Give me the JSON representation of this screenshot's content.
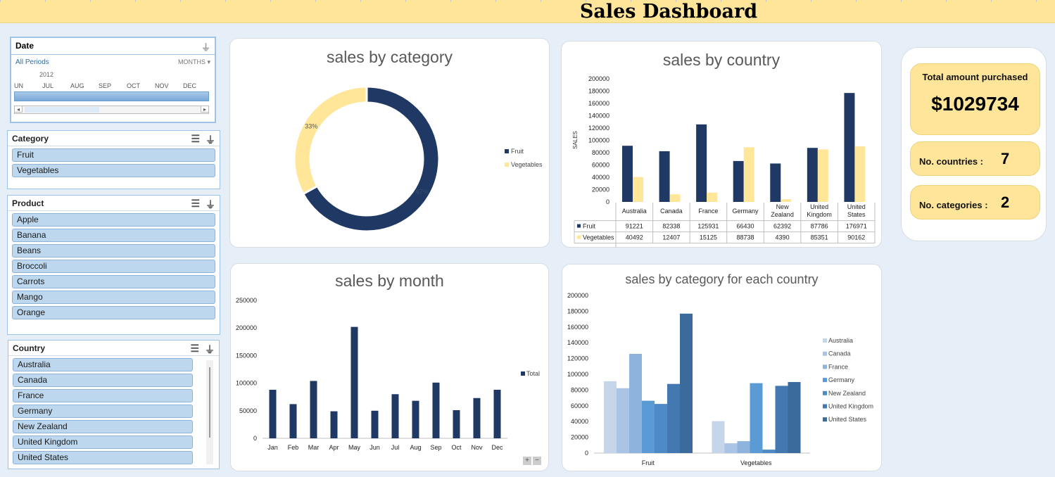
{
  "header": {
    "title": "Sales Dashboard"
  },
  "date_slicer": {
    "title": "Date",
    "all_periods": "All Periods",
    "period_select": "MONTHS",
    "year": "2012",
    "months": [
      "UN",
      "JUL",
      "AUG",
      "SEP",
      "OCT",
      "NOV",
      "DEC"
    ]
  },
  "category_slicer": {
    "title": "Category",
    "items": [
      {
        "label": "Fruit"
      },
      {
        "label": "Vegetables"
      }
    ]
  },
  "product_slicer": {
    "title": "Product",
    "items": [
      {
        "label": "Apple"
      },
      {
        "label": "Banana"
      },
      {
        "label": "Beans"
      },
      {
        "label": "Broccoli"
      },
      {
        "label": "Carrots"
      },
      {
        "label": "Mango"
      },
      {
        "label": "Orange"
      }
    ]
  },
  "country_slicer": {
    "title": "Country",
    "items": [
      {
        "label": "Australia"
      },
      {
        "label": "Canada"
      },
      {
        "label": "France"
      },
      {
        "label": "Germany"
      },
      {
        "label": "New Zealand"
      },
      {
        "label": "United Kingdom"
      },
      {
        "label": "United States"
      }
    ]
  },
  "kpis": {
    "total_label": "Total amount purchased",
    "total_value": "$1029734",
    "countries_label": "No. countries :",
    "countries_value": "7",
    "categories_label": "No. categories :",
    "categories_value": "2"
  },
  "colors": {
    "fruit": "#203864",
    "vegetables": "#ffe699"
  },
  "chart_data": [
    {
      "id": "category",
      "type": "pie",
      "title": "sales by category",
      "labels": [
        "Fruit",
        "Vegetables"
      ],
      "values": [
        67,
        33
      ],
      "data_labels": [
        "67%",
        "33%"
      ],
      "legend": "right"
    },
    {
      "id": "country",
      "type": "bar",
      "title": "sales by country",
      "ylabel": "SALES",
      "ylim": [
        0,
        200000
      ],
      "yticks": [
        "0",
        "20000",
        "40000",
        "60000",
        "80000",
        "100000",
        "120000",
        "140000",
        "160000",
        "180000",
        "200000"
      ],
      "categories": [
        "Australia",
        "Canada",
        "France",
        "Germany",
        "New Zealand",
        "United Kingdom",
        "United States"
      ],
      "series": [
        {
          "name": "Fruit",
          "values": [
            91221,
            82338,
            125931,
            66430,
            62392,
            87786,
            176971
          ]
        },
        {
          "name": "Vegetables",
          "values": [
            40492,
            12407,
            15125,
            88738,
            4390,
            85351,
            90162
          ]
        }
      ],
      "data_table": true
    },
    {
      "id": "month",
      "type": "bar",
      "title": "sales by month",
      "ylim": [
        0,
        250000
      ],
      "yticks": [
        "0",
        "50000",
        "100000",
        "150000",
        "200000",
        "250000"
      ],
      "categories": [
        "Jan",
        "Feb",
        "Mar",
        "Apr",
        "May",
        "Jun",
        "Jul",
        "Aug",
        "Sep",
        "Oct",
        "Nov",
        "Dec"
      ],
      "series": [
        {
          "name": "Total",
          "values": [
            88000,
            62000,
            104000,
            49000,
            202000,
            50000,
            80000,
            68000,
            101000,
            51000,
            73000,
            88000
          ]
        }
      ],
      "legend": "right"
    },
    {
      "id": "catcountry",
      "type": "bar",
      "title": "sales by category for each country",
      "ylim": [
        0,
        200000
      ],
      "yticks": [
        "0",
        "20000",
        "40000",
        "60000",
        "80000",
        "100000",
        "120000",
        "140000",
        "160000",
        "180000",
        "200000"
      ],
      "categories": [
        "Fruit",
        "Vegetables"
      ],
      "series": [
        {
          "name": "Australia",
          "values": [
            91221,
            40492
          ],
          "color": "#c5d5ea"
        },
        {
          "name": "Canada",
          "values": [
            82338,
            12407
          ],
          "color": "#a9c4e4"
        },
        {
          "name": "France",
          "values": [
            125931,
            15125
          ],
          "color": "#8eb3dd"
        },
        {
          "name": "Germany",
          "values": [
            66430,
            88738
          ],
          "color": "#5b9bd5"
        },
        {
          "name": "New Zealand",
          "values": [
            62392,
            4390
          ],
          "color": "#4e8bc6"
        },
        {
          "name": "United Kingdom",
          "values": [
            87786,
            85351
          ],
          "color": "#4478b0"
        },
        {
          "name": "United States",
          "values": [
            176971,
            90162
          ],
          "color": "#3b6a9c"
        }
      ],
      "legend": "right"
    }
  ]
}
